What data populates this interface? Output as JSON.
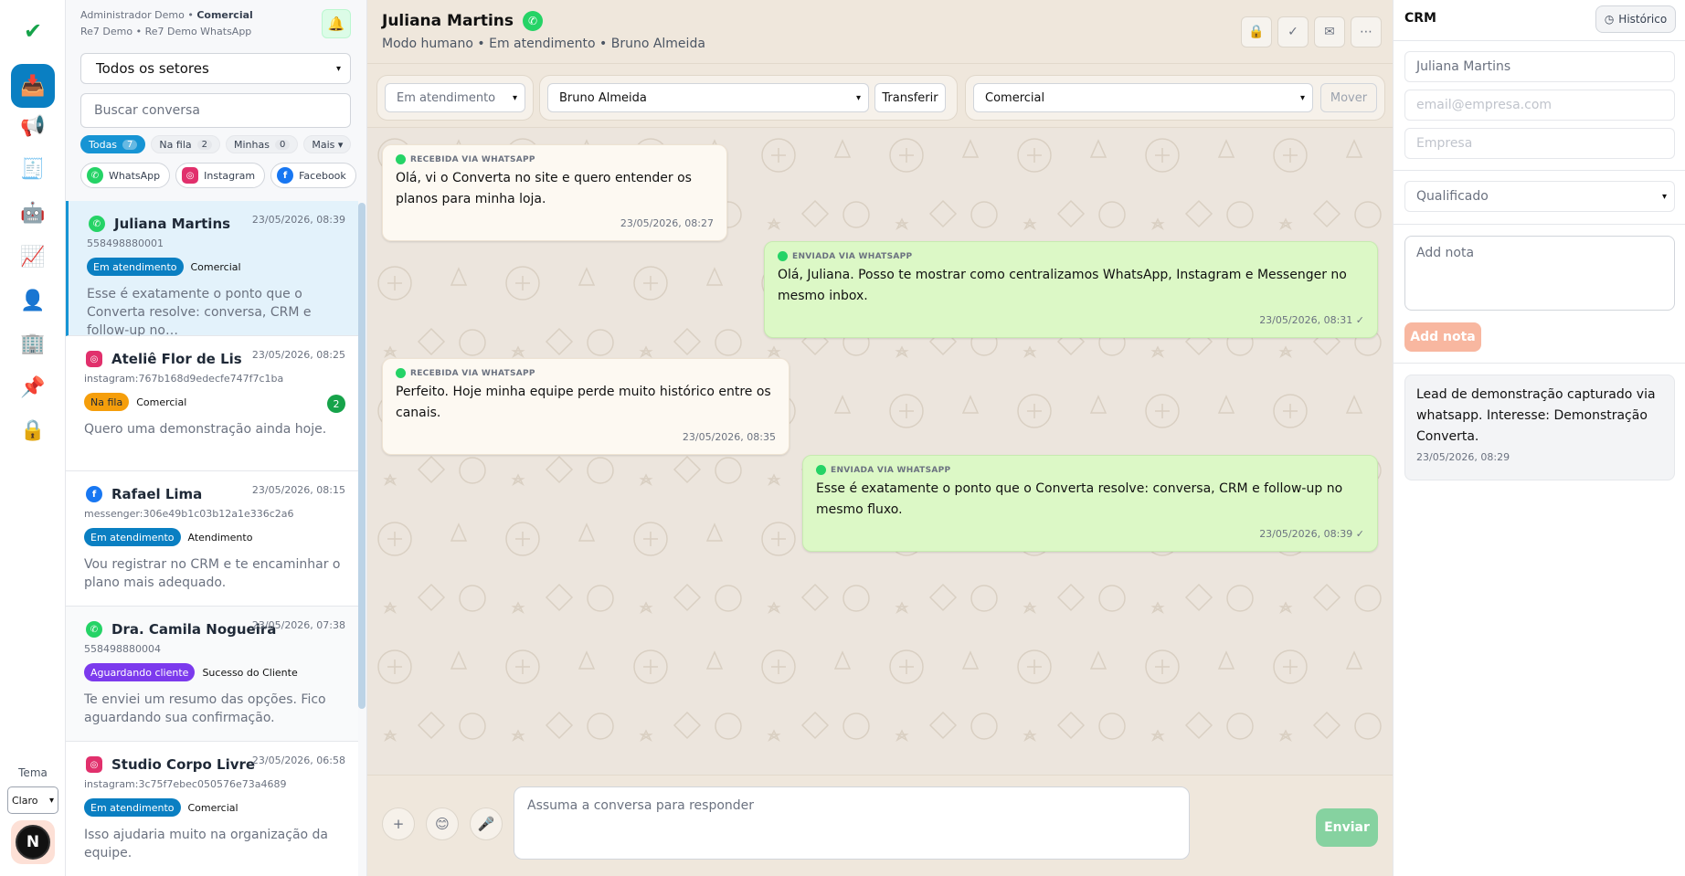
{
  "rail": {
    "icons": [
      {
        "name": "check-icon",
        "glyph": "✔",
        "color": "#16a34a"
      },
      {
        "name": "inbox-icon",
        "glyph": "📥",
        "color": "#ffffff"
      },
      {
        "name": "megaphone-icon",
        "glyph": "📢",
        "color": "#e11d48"
      },
      {
        "name": "receipt-icon",
        "glyph": "🧾",
        "color": "#0a7fc2"
      },
      {
        "name": "robot-icon",
        "glyph": "🤖",
        "color": "#6b7280"
      },
      {
        "name": "chart-icon",
        "glyph": "📈",
        "color": "#e11d48"
      },
      {
        "name": "user-icon",
        "glyph": "👤",
        "color": "#0a7fc2"
      },
      {
        "name": "building-icon",
        "glyph": "🏢",
        "color": "#6b7280"
      },
      {
        "name": "pin-icon",
        "glyph": "📌",
        "color": "#e11d48"
      },
      {
        "name": "lock-icon",
        "glyph": "🔒",
        "color": "#f59e0b"
      }
    ],
    "theme_label": "Tema",
    "theme_value": "Claro",
    "avatar_letter": "N"
  },
  "conversations_panel": {
    "account_user": "Administrador Demo • ",
    "account_sector": "Comercial",
    "account_org": "Re7 Demo • Re7 Demo WhatsApp",
    "sector_select": "Todos os setores",
    "search_placeholder": "Buscar conversa",
    "filters": [
      {
        "label": "Todas",
        "count": "7"
      },
      {
        "label": "Na fila",
        "count": "2"
      },
      {
        "label": "Minhas",
        "count": "0"
      }
    ],
    "more_label": "Mais ▾",
    "channels": [
      "WhatsApp",
      "Instagram",
      "Facebook"
    ],
    "items": [
      {
        "channel": "whatsapp",
        "name": "Juliana Martins",
        "time": "23/05/2026, 08:39",
        "id": "558498880001",
        "status": "Em atendimento",
        "sector": "Comercial",
        "preview": "Esse é exatamente o ponto que o Converta resolve: conversa, CRM e follow-up no…",
        "badge": ""
      },
      {
        "channel": "instagram",
        "name": "Ateliê Flor de Lis",
        "time": "23/05/2026, 08:25",
        "id": "instagram:767b168d9edecfe747f7c1ba",
        "status": "Na fila",
        "sector": "Comercial",
        "preview": "Quero uma demonstração ainda hoje.",
        "badge": "2"
      },
      {
        "channel": "facebook",
        "name": "Rafael Lima",
        "time": "23/05/2026, 08:15",
        "id": "messenger:306e49b1c03b12a1e336c2a6",
        "status": "Em atendimento",
        "sector": "Atendimento",
        "preview": "Vou registrar no CRM e te encaminhar o plano mais adequado.",
        "badge": ""
      },
      {
        "channel": "whatsapp",
        "name": "Dra. Camila Nogueira",
        "time": "23/05/2026, 07:38",
        "id": "558498880004",
        "status": "Aguardando cliente",
        "sector": "Sucesso do Cliente",
        "preview": "Te enviei um resumo das opções. Fico aguardando sua confirmação.",
        "badge": ""
      },
      {
        "channel": "instagram",
        "name": "Studio Corpo Livre",
        "time": "23/05/2026, 06:58",
        "id": "instagram:3c75f7ebec050576e73a4689",
        "status": "Em atendimento",
        "sector": "Comercial",
        "preview": "Isso ajudaria muito na organização da equipe.",
        "badge": ""
      }
    ]
  },
  "chat": {
    "contact_name": "Juliana Martins",
    "subtitle": "Modo humano • Em atendimento • Bruno Almeida",
    "status_select": "Em atendimento",
    "agent_select": "Bruno Almeida",
    "transfer_label": "Transferir",
    "sector_select": "Comercial",
    "move_label": "Mover",
    "messages": [
      {
        "direction": "in",
        "label": "Recebida via WhatsApp",
        "text": "Olá, vi o Converta no site e quero entender os planos para minha loja.",
        "time": "23/05/2026, 08:27"
      },
      {
        "direction": "out",
        "label": "Enviada via WhatsApp",
        "text": "Olá, Juliana. Posso te mostrar como centralizamos WhatsApp, Instagram e Messenger no mesmo inbox.",
        "time": "23/05/2026, 08:31 ✓"
      },
      {
        "direction": "in",
        "label": "Recebida via WhatsApp",
        "text": "Perfeito. Hoje minha equipe perde muito histórico entre os canais.",
        "time": "23/05/2026, 08:35"
      },
      {
        "direction": "out",
        "label": "Enviada via WhatsApp",
        "text": "Esse é exatamente o ponto que o Converta resolve: conversa, CRM e follow-up no mesmo fluxo.",
        "time": "23/05/2026, 08:39 ✓"
      }
    ],
    "composer_placeholder": "Assuma a conversa para responder",
    "send_label": "Enviar"
  },
  "crm": {
    "title": "CRM",
    "history_label": "Histórico",
    "name_value": "Juliana Martins",
    "email_placeholder": "email@empresa.com",
    "company_placeholder": "Empresa",
    "stage_select": "Qualificado",
    "note_placeholder": "Add nota",
    "add_note_label": "Add nota",
    "notes": [
      {
        "text": "Lead de demonstração capturado via whatsapp. Interesse: Demonstração Converta.",
        "time": "23/05/2026, 08:29"
      }
    ]
  },
  "colors": {
    "accent": "#0a7fc2",
    "whatsapp": "#25d366",
    "instagram": "#e1306c",
    "facebook": "#1877f2",
    "chat_background": "#ece5dd",
    "outgoing_bubble": "#dcf8c6"
  }
}
